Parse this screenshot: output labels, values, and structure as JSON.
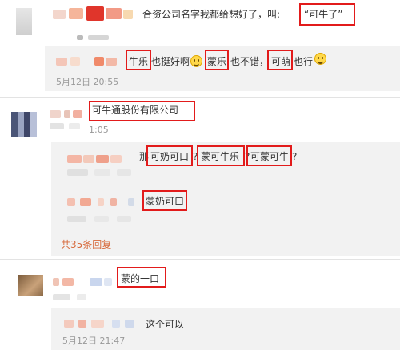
{
  "comments": [
    {
      "text_prefix": "合资公司名字我都给想好了，叫:",
      "highlight": "“可牛了”",
      "replies": [
        {
          "parts": [
            "牛乐",
            "也挺好啊",
            "蒙乐",
            "也不错，",
            "可萌",
            "也行"
          ],
          "emoji_name": "smile-emoji-icon",
          "time": "5月12日 20:55"
        }
      ]
    },
    {
      "highlight": "可牛通股份有限公司",
      "time": "1:05",
      "replies": [
        {
          "parts": [
            "那",
            "可奶可口",
            "?",
            "蒙可牛乐",
            "?",
            "可蒙可牛",
            "?"
          ]
        },
        {
          "highlight": "蒙奶可口"
        }
      ],
      "more_replies": "共35条回复"
    },
    {
      "highlight": "蒙的一口",
      "replies": [
        {
          "text": "这个可以",
          "time": "5月12日 21:47"
        }
      ]
    }
  ],
  "colors": {
    "highlight_border": "#e21b1b",
    "more_link": "#d76a3c",
    "reply_background": "#f2f2f2"
  }
}
